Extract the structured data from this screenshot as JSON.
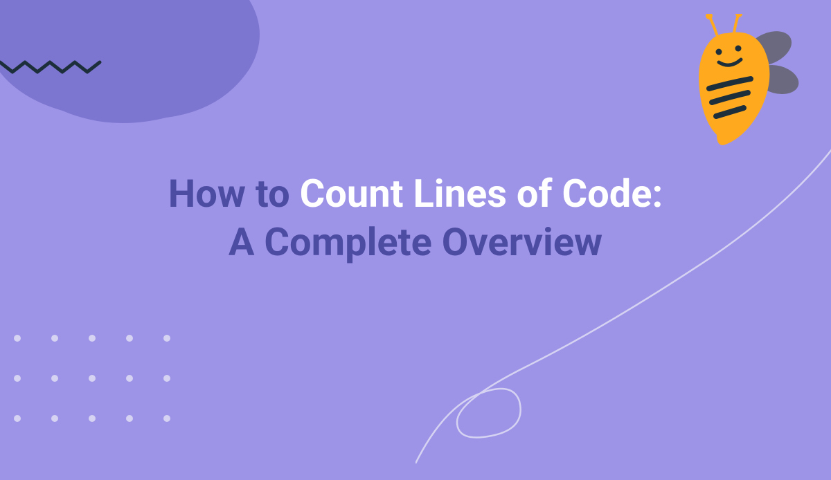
{
  "title": {
    "part1": "How to ",
    "part2": "Count Lines of Code: ",
    "part3": "A Complete Overview"
  },
  "colors": {
    "background": "#9D94E8",
    "blob": "#7D76D0",
    "titleDark": "#4D4CA3",
    "titleLight": "#FFFFFF",
    "zigzag": "#1E2F3C",
    "dot": "#D5D2F2",
    "beeBody": "#FFA91F",
    "beeWing": "#6B697F",
    "curve": "#D5D2F2"
  }
}
